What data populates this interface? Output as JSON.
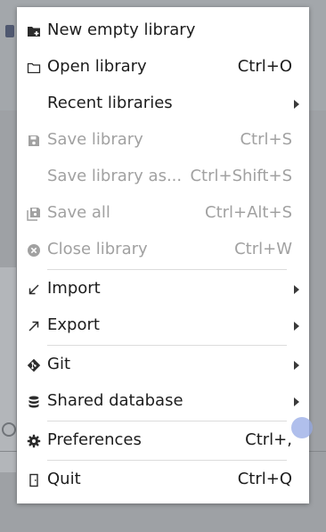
{
  "menu": {
    "items": [
      {
        "label": "New empty library",
        "shortcut": "",
        "icon": "new-library-icon",
        "enabled": true,
        "submenu": false
      },
      {
        "label": "Open library",
        "shortcut": "Ctrl+O",
        "icon": "folder-icon",
        "enabled": true,
        "submenu": false
      },
      {
        "label": "Recent libraries",
        "shortcut": "",
        "icon": "",
        "enabled": true,
        "submenu": true
      },
      {
        "label": "Save library",
        "shortcut": "Ctrl+S",
        "icon": "save-icon",
        "enabled": false,
        "submenu": false
      },
      {
        "label": "Save library as...",
        "shortcut": "Ctrl+Shift+S",
        "icon": "",
        "enabled": false,
        "submenu": false
      },
      {
        "label": "Save all",
        "shortcut": "Ctrl+Alt+S",
        "icon": "save-all-icon",
        "enabled": false,
        "submenu": false
      },
      {
        "label": "Close library",
        "shortcut": "Ctrl+W",
        "icon": "close-circle-icon",
        "enabled": false,
        "submenu": false
      },
      {
        "label": "Import",
        "shortcut": "",
        "icon": "import-arrow-icon",
        "enabled": true,
        "submenu": true
      },
      {
        "label": "Export",
        "shortcut": "",
        "icon": "export-arrow-icon",
        "enabled": true,
        "submenu": true
      },
      {
        "label": "Git",
        "shortcut": "",
        "icon": "git-icon",
        "enabled": true,
        "submenu": true
      },
      {
        "label": "Shared database",
        "shortcut": "",
        "icon": "database-icon",
        "enabled": true,
        "submenu": true
      },
      {
        "label": "Preferences",
        "shortcut": "Ctrl+,",
        "icon": "gear-icon",
        "enabled": true,
        "submenu": false
      },
      {
        "label": "Quit",
        "shortcut": "Ctrl+Q",
        "icon": "exit-icon",
        "enabled": true,
        "submenu": false
      }
    ]
  },
  "colors": {
    "text": "#1d1d1d",
    "disabled_text": "#a1a1a1",
    "menu_background": "#ffffff",
    "separator": "#dcdcdc"
  }
}
